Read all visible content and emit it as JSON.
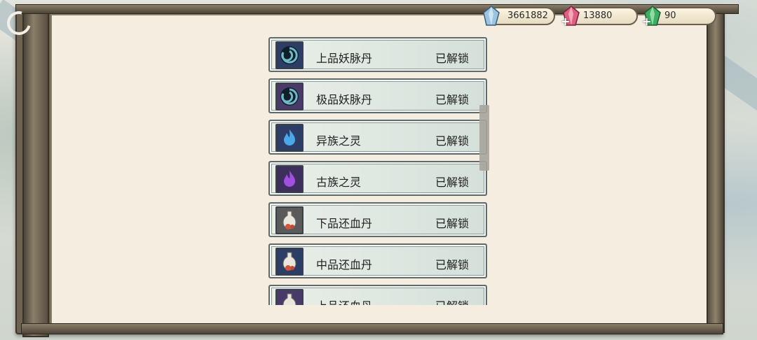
{
  "currencies": [
    {
      "id": "silver",
      "value": "3661882",
      "color": "#8fb6d6"
    },
    {
      "id": "ruby",
      "value": "13880",
      "color": "#d85a7a"
    },
    {
      "id": "jade",
      "value": "90",
      "color": "#3aa65e"
    }
  ],
  "items": [
    {
      "name": "上品妖脉丹",
      "status": "已解锁",
      "icon": "spiral-orb-icon",
      "bg": "#2c3d66"
    },
    {
      "name": "极品妖脉丹",
      "status": "已解锁",
      "icon": "spiral-orb-icon",
      "bg": "#4a3a6a"
    },
    {
      "name": "异族之灵",
      "status": "已解锁",
      "icon": "blue-flame-icon",
      "bg": "#2c3d66"
    },
    {
      "name": "古族之灵",
      "status": "已解锁",
      "icon": "purple-flame-icon",
      "bg": "#3c2f5e"
    },
    {
      "name": "下品还血丹",
      "status": "已解锁",
      "icon": "potion-gourd-icon",
      "bg": "#5a5a5a"
    },
    {
      "name": "中品还血丹",
      "status": "已解锁",
      "icon": "potion-gourd-icon",
      "bg": "#2c3d66"
    },
    {
      "name": "上品还血丹",
      "status": "已解锁",
      "icon": "potion-gourd-icon",
      "bg": "#4a3a6a"
    }
  ]
}
